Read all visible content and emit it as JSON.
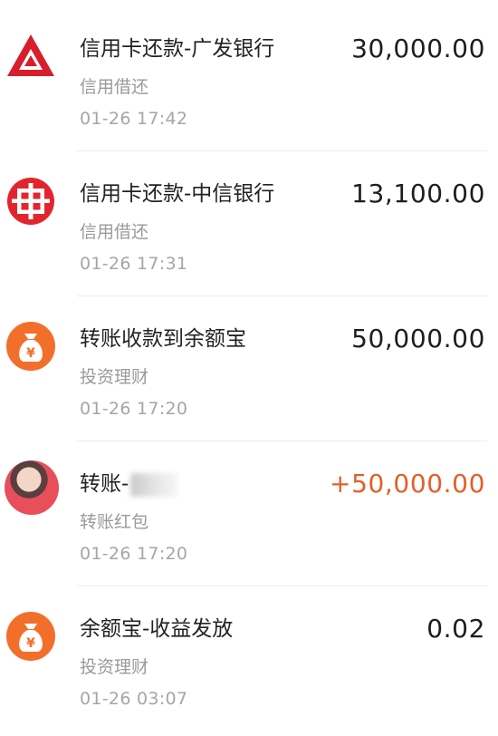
{
  "transactions": [
    {
      "title": "信用卡还款-广发银行",
      "category": "信用借还",
      "time": "01-26  17:42",
      "amount": "30,000.00",
      "icon": "cgb-bank-logo-icon",
      "icon_color": "#d81e2c"
    },
    {
      "title": "信用卡还款-中信银行",
      "category": "信用借还",
      "time": "01-26  17:31",
      "amount": "13,100.00",
      "icon": "citic-bank-logo-icon",
      "icon_color": "#e2252d"
    },
    {
      "title": "转账收款到余额宝",
      "category": "投资理财",
      "time": "01-26  17:20",
      "amount": "50,000.00",
      "icon": "money-bag-yuan-icon",
      "icon_color": "#f26f2b"
    },
    {
      "title": "转账-",
      "category": "转账红包",
      "time": "01-26  17:20",
      "amount": "+50,000.00",
      "icon": "avatar",
      "amount_color": "#e2602a"
    },
    {
      "title": "余额宝-收益发放",
      "category": "投资理财",
      "time": "01-26  03:07",
      "amount": "0.02",
      "icon": "money-bag-yuan-icon",
      "icon_color": "#f26f2b"
    }
  ]
}
